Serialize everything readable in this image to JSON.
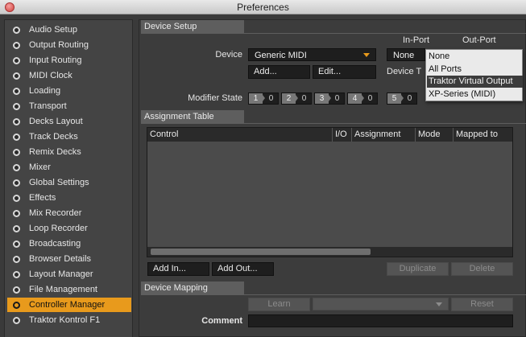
{
  "window": {
    "title": "Preferences"
  },
  "sidebar": {
    "items": [
      {
        "label": "Audio Setup",
        "active": false
      },
      {
        "label": "Output Routing",
        "active": false
      },
      {
        "label": "Input Routing",
        "active": false
      },
      {
        "label": "MIDI Clock",
        "active": false
      },
      {
        "label": "Loading",
        "active": false
      },
      {
        "label": "Transport",
        "active": false
      },
      {
        "label": "Decks Layout",
        "active": false
      },
      {
        "label": "Track Decks",
        "active": false
      },
      {
        "label": "Remix Decks",
        "active": false
      },
      {
        "label": "Mixer",
        "active": false
      },
      {
        "label": "Global Settings",
        "active": false
      },
      {
        "label": "Effects",
        "active": false
      },
      {
        "label": "Mix Recorder",
        "active": false
      },
      {
        "label": "Loop Recorder",
        "active": false
      },
      {
        "label": "Broadcasting",
        "active": false
      },
      {
        "label": "Browser Details",
        "active": false
      },
      {
        "label": "Layout Manager",
        "active": false
      },
      {
        "label": "File Management",
        "active": false
      },
      {
        "label": "Controller Manager",
        "active": true
      },
      {
        "label": "Traktor Kontrol F1",
        "active": false
      }
    ]
  },
  "device_setup": {
    "section_title": "Device Setup",
    "device_label": "Device",
    "device_value": "Generic MIDI",
    "in_port_label": "In-Port",
    "out_port_label": "Out-Port",
    "in_port_value": "None",
    "add_button": "Add...",
    "edit_button": "Edit...",
    "device_target_label": "Device T",
    "modifier_label": "Modifier State",
    "modifiers": [
      {
        "num": "1",
        "val": "0"
      },
      {
        "num": "2",
        "val": "0"
      },
      {
        "num": "3",
        "val": "0"
      },
      {
        "num": "4",
        "val": "0"
      },
      {
        "num": "5",
        "val": "0"
      }
    ]
  },
  "assignment_table": {
    "section_title": "Assignment Table",
    "columns": [
      "Control",
      "I/O",
      "Assignment",
      "Mode",
      "Mapped to"
    ],
    "rows": [],
    "add_in_button": "Add In...",
    "add_out_button": "Add Out...",
    "duplicate_button": "Duplicate",
    "delete_button": "Delete"
  },
  "device_mapping": {
    "section_title": "Device Mapping",
    "learn_button": "Learn",
    "reset_button": "Reset",
    "comment_label": "Comment",
    "comment_value": ""
  },
  "port_popup": {
    "options": [
      "None",
      "All Ports",
      "Traktor Virtual Output",
      "XP-Series (MIDI)"
    ],
    "highlighted_index": 2
  },
  "colors": {
    "accent": "#e89a1c",
    "panel": "#3c3c3c",
    "section_header": "#5e5e5e",
    "field": "#1e1e1e"
  }
}
